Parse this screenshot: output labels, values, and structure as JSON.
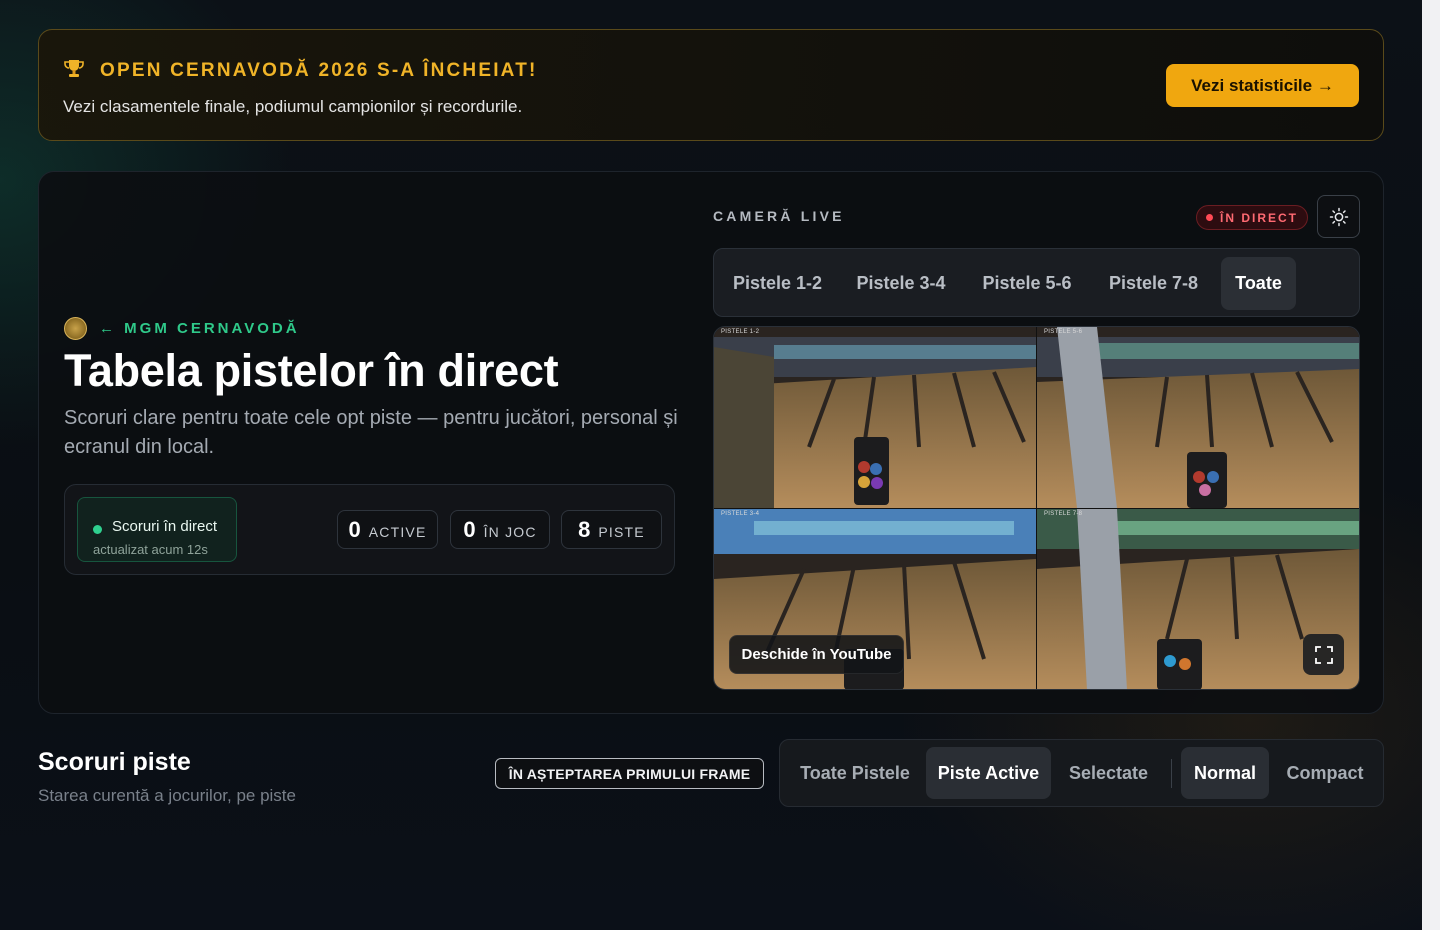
{
  "colors": {
    "accent_gold": "#f0a70f",
    "accent_green": "#2fc98a",
    "live_red": "#ff4a55",
    "background": "#0b0f14"
  },
  "banner": {
    "icon": "trophy-icon",
    "title": "OPEN CERNAVODĂ 2026 S-A ÎNCHEIAT!",
    "subtitle": "Vezi clasamentele finale, podiumul campionilor și recordurile.",
    "cta_label": "Vezi statisticile →"
  },
  "hero": {
    "brand": "← MGM CERNAVODĂ",
    "title": "Tabela pistelor în direct",
    "description": "Scoruri clare pentru toate cele opt piste — pentru jucători, personal și ecranul din local.",
    "live_status": {
      "label": "Scoruri în direct",
      "updated": "actualizat acum 12s"
    },
    "stats": [
      {
        "value": "0",
        "label": "ACTIVE"
      },
      {
        "value": "0",
        "label": "ÎN JOC"
      },
      {
        "value": "8",
        "label": "PISTE"
      }
    ]
  },
  "camera": {
    "label": "CAMERĂ LIVE",
    "live_badge": "ÎN DIRECT",
    "tabs": [
      "Pistele 1-2",
      "Pistele 3-4",
      "Pistele 5-6",
      "Pistele 7-8",
      "Toate"
    ],
    "active_tab": "Toate",
    "feeds": [
      "PISTELE 1-2",
      "PISTELE 5-6",
      "PISTELE 3-4",
      "PISTELE 7-8"
    ],
    "youtube_label": "Deschide în YouTube"
  },
  "scores": {
    "title": "Scoruri piste",
    "subtitle": "Starea curentă a jocurilor, pe piste",
    "waiting_badge": "ÎN AȘTEPTAREA PRIMULUI FRAME",
    "filters": [
      "Toate Pistele",
      "Piste Active",
      "Selectate"
    ],
    "active_filter": "Piste Active",
    "views": [
      "Normal",
      "Compact"
    ],
    "active_view": "Normal"
  }
}
